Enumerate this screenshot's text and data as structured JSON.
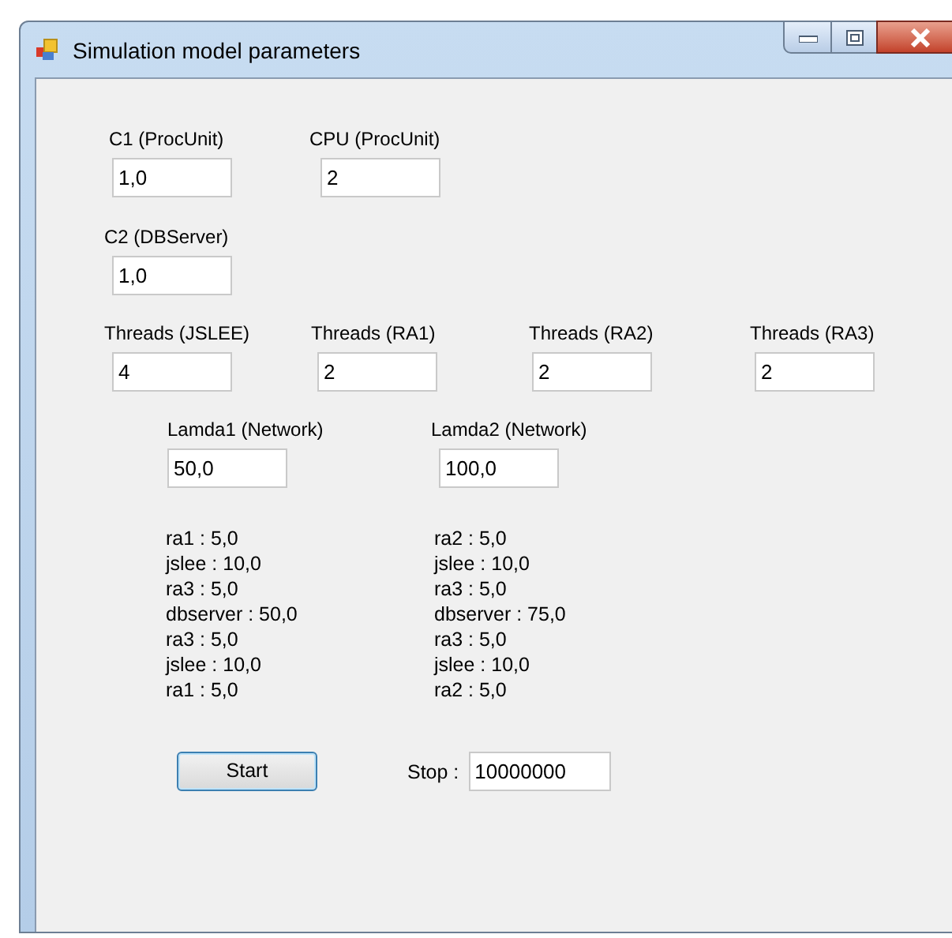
{
  "window": {
    "title": "Simulation model parameters"
  },
  "rows": [
    [
      {
        "label": "C1 (ProcUnit)",
        "value": "1,0"
      },
      {
        "label": "CPU (ProcUnit)",
        "value": "2"
      }
    ],
    [
      {
        "label": "C2 (DBServer)",
        "value": "1,0"
      }
    ],
    [
      {
        "label": "Threads (JSLEE)",
        "value": "4"
      },
      {
        "label": "Threads (RA1)",
        "value": "2"
      },
      {
        "label": "Threads (RA2)",
        "value": "2"
      },
      {
        "label": "Threads (RA3)",
        "value": "2"
      }
    ],
    [
      {
        "label": "Lamda1 (Network)",
        "value": "50,0"
      },
      {
        "label": "Lamda2 (Network)",
        "value": "100,0"
      }
    ]
  ],
  "paths": [
    {
      "lines": [
        "ra1 : 5,0",
        "jslee : 10,0",
        "ra3 : 5,0",
        "dbserver : 50,0",
        "ra3 : 5,0",
        "jslee : 10,0",
        "ra1 : 5,0"
      ]
    },
    {
      "lines": [
        "ra2 : 5,0",
        "jslee : 10,0",
        "ra3 : 5,0",
        "dbserver : 75,0",
        "ra3 : 5,0",
        "jslee : 10,0",
        "ra2 : 5,0"
      ]
    }
  ],
  "start_button": "Start",
  "stop": {
    "label": "Stop :",
    "value": "10000000"
  }
}
